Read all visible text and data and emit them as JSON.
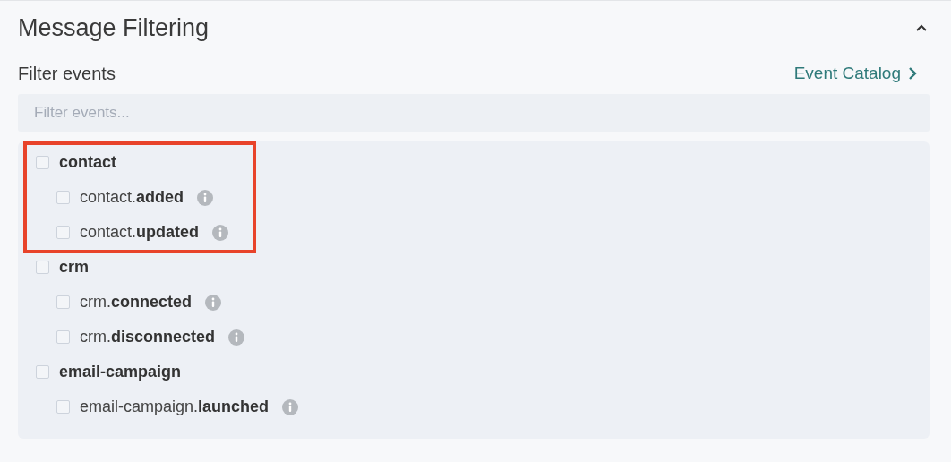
{
  "section": {
    "title": "Message Filtering",
    "expanded": true
  },
  "filter": {
    "label": "Filter events",
    "link": "Event Catalog",
    "placeholder": "Filter events..."
  },
  "groups": [
    {
      "name": "contact",
      "checked": false,
      "highlighted": true,
      "events": [
        {
          "label": "contact.**added**",
          "checked": false
        },
        {
          "label": "contact.**updated**",
          "checked": false
        }
      ]
    },
    {
      "name": "crm",
      "checked": false,
      "highlighted": false,
      "events": [
        {
          "label": "crm.**connected**",
          "checked": false
        },
        {
          "label": "crm.**disconnected**",
          "checked": false
        }
      ]
    },
    {
      "name": "email-campaign",
      "checked": false,
      "highlighted": false,
      "events": [
        {
          "label": "email-campaign.**launched**",
          "checked": false
        }
      ]
    }
  ]
}
